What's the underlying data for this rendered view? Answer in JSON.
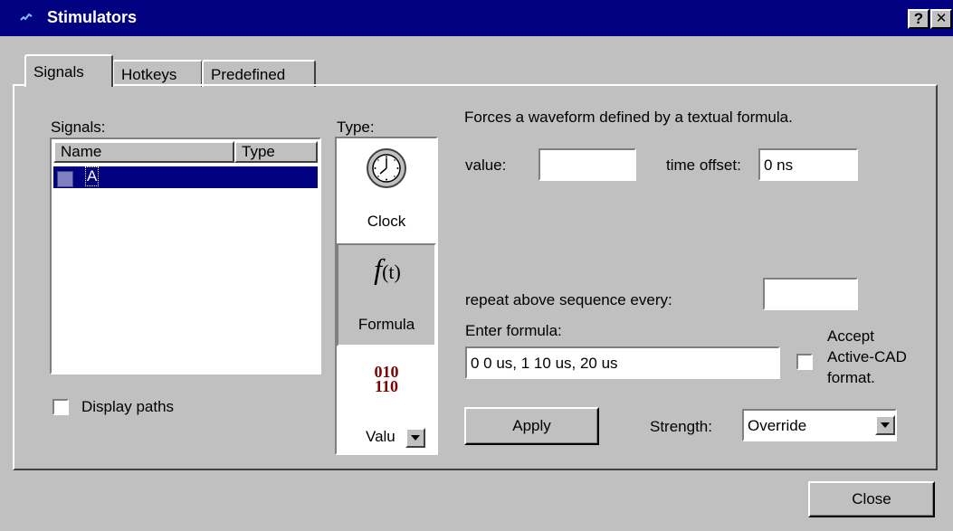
{
  "window": {
    "title": "Stimulators",
    "help_btn": "?",
    "close_btn": "✕"
  },
  "tabs": [
    {
      "label": "Signals",
      "active": true
    },
    {
      "label": "Hotkeys",
      "active": false
    },
    {
      "label": "Predefined",
      "active": false
    }
  ],
  "signals": {
    "label": "Signals:",
    "columns": [
      "Name",
      "Type"
    ],
    "rows": [
      {
        "name": "A",
        "type": "",
        "selected": true
      }
    ],
    "display_paths_label": "Display paths",
    "display_paths_checked": false
  },
  "type_panel": {
    "label": "Type:",
    "items": [
      {
        "label": "Clock",
        "icon": "clock-icon"
      },
      {
        "label": "Formula",
        "icon": "formula-icon",
        "glyph_f": "f",
        "glyph_t": "(t)",
        "selected": true
      },
      {
        "label": "Valu",
        "icon": "binary-value-icon",
        "glyph_top": "010",
        "glyph_bottom": "110"
      }
    ]
  },
  "formula": {
    "description": "Forces a waveform defined by a textual formula.",
    "value_label": "value:",
    "value": "",
    "time_offset_label": "time offset:",
    "time_offset": "0 ns",
    "repeat_label": "repeat above sequence every:",
    "repeat_value": "",
    "enter_formula_label": "Enter formula:",
    "formula_value": "0 0 us, 1 10 us, 20 us",
    "accept_label_1": "Accept",
    "accept_label_2": "Active-CAD",
    "accept_label_3": "format.",
    "accept_checked": false,
    "apply_label": "Apply",
    "strength_label": "Strength:",
    "strength_value": "Override"
  },
  "footer": {
    "close_label": "Close"
  },
  "colors": {
    "titlebar": "#000080",
    "face": "#c0c0c0",
    "selection": "#000080",
    "binary_icon": "#800000"
  }
}
